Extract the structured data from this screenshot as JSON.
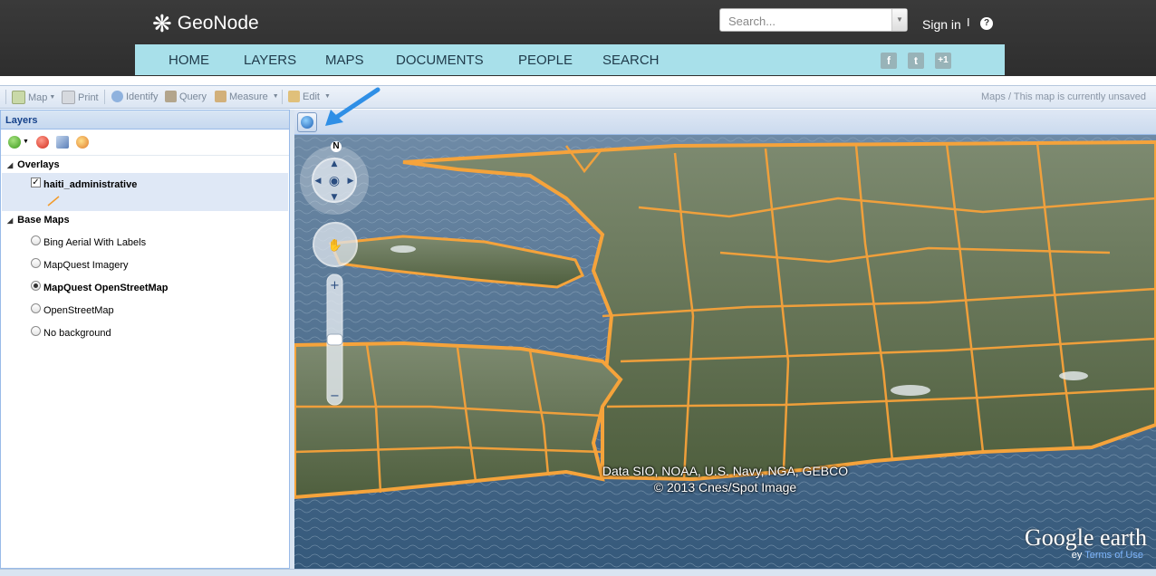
{
  "header": {
    "logo_text": "GeoNode",
    "search_placeholder": "Search...",
    "sign_in": "Sign in",
    "separator": "I",
    "help": "?"
  },
  "nav": {
    "items": [
      "HOME",
      "LAYERS",
      "MAPS",
      "DOCUMENTS",
      "PEOPLE",
      "SEARCH"
    ],
    "social": [
      "f",
      "t",
      "+1"
    ]
  },
  "toolbar": {
    "map": "Map",
    "print": "Print",
    "identify": "Identify",
    "query": "Query",
    "measure": "Measure",
    "edit": "Edit",
    "breadcrumb": "Maps / This map is currently unsaved"
  },
  "layers_panel": {
    "title": "Layers",
    "overlays_label": "Overlays",
    "overlay_layer": "haiti_administrative",
    "basemaps_label": "Base Maps",
    "basemaps": [
      {
        "label": "Bing Aerial With Labels",
        "selected": false
      },
      {
        "label": "MapQuest Imagery",
        "selected": false
      },
      {
        "label": "MapQuest OpenStreetMap",
        "selected": true
      },
      {
        "label": "OpenStreetMap",
        "selected": false
      },
      {
        "label": "No background",
        "selected": false
      }
    ]
  },
  "map": {
    "compass_label": "N",
    "attribution_line1": "Data SIO, NOAA, U.S. Navy, NGA, GEBCO",
    "attribution_line2": "© 2013 Cnes/Spot Image",
    "logo": "Google earth",
    "terms_prefix": "ey",
    "terms": "Terms of Use",
    "boundary_color": "#f7a23a",
    "sea_color": "#3c5f7e"
  }
}
